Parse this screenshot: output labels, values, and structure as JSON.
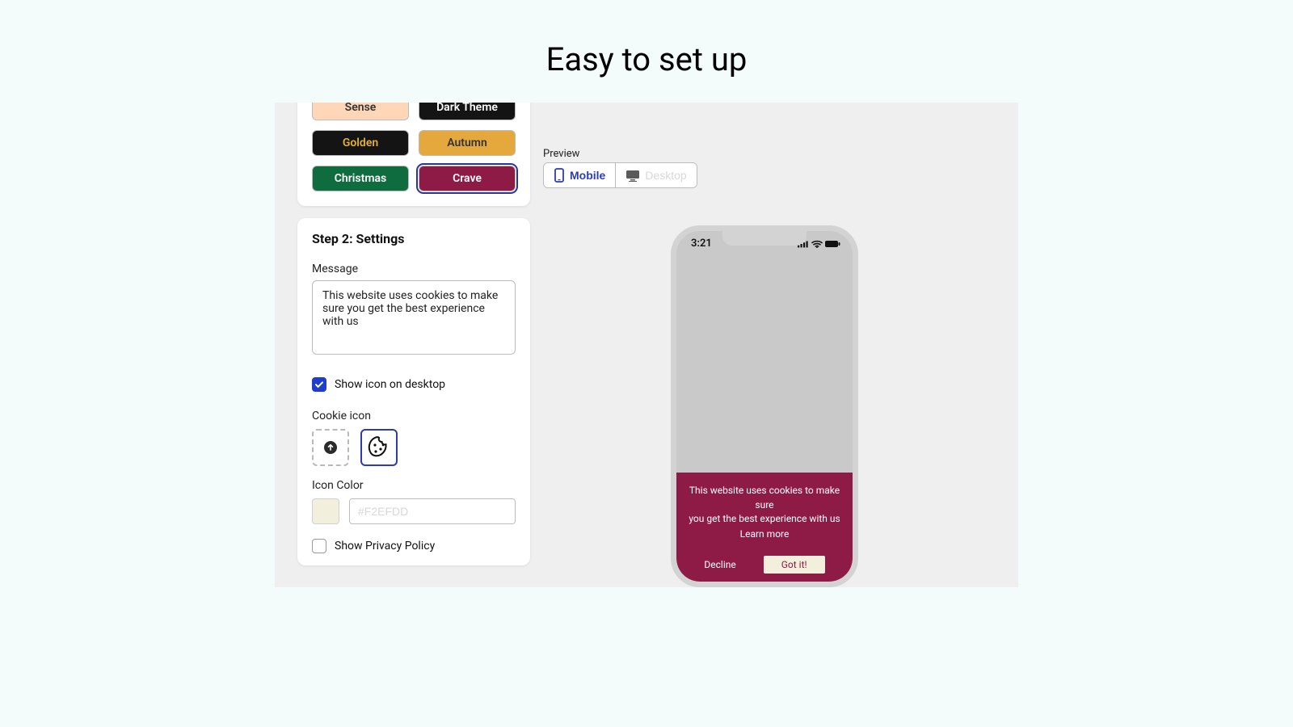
{
  "page": {
    "title": "Easy to set up"
  },
  "themes": {
    "sense": "Sense",
    "dark": "Dark Theme",
    "golden": "Golden",
    "autumn": "Autumn",
    "christmas": "Christmas",
    "crave": "Crave"
  },
  "settings": {
    "step_heading": "Step 2: Settings",
    "message_label": "Message",
    "message_value": "This website uses cookies to make sure you get the best experience with us",
    "show_icon_label": "Show icon on desktop",
    "cookie_icon_label": "Cookie icon",
    "icon_color_label": "Icon Color",
    "icon_color_value": "#F2EFDD",
    "show_privacy_label": "Show Privacy Policy"
  },
  "preview": {
    "label": "Preview",
    "mobile": "Mobile",
    "desktop": "Desktop",
    "phone_time": "3:21",
    "banner_msg_l1": "This website uses cookies to make sure",
    "banner_msg_l2": "you get the best experience with us",
    "banner_link": "Learn more",
    "decline": "Decline",
    "accept": "Got it!"
  }
}
